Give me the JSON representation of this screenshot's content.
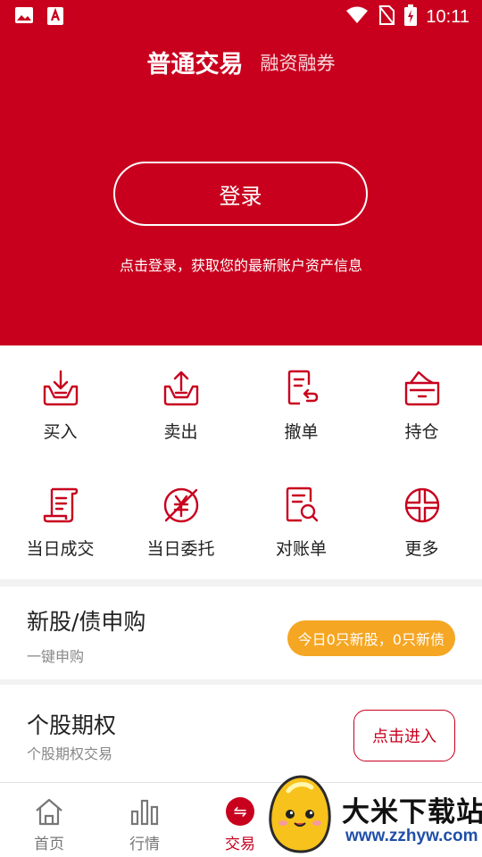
{
  "status_bar": {
    "time": "10:11",
    "icons": [
      "image-icon",
      "app-notification-icon",
      "wifi-icon",
      "no-sim-icon",
      "battery-charging-icon"
    ]
  },
  "header": {
    "tab_active": "普通交易",
    "tab_inactive": "融资融券",
    "login_button": "登录",
    "login_hint": "点击登录，获取您的最新账户资产信息"
  },
  "grid": [
    {
      "label": "买入",
      "icon": "buy-icon"
    },
    {
      "label": "卖出",
      "icon": "sell-icon"
    },
    {
      "label": "撤单",
      "icon": "cancel-order-icon"
    },
    {
      "label": "持仓",
      "icon": "position-icon"
    },
    {
      "label": "当日成交",
      "icon": "daily-deal-icon"
    },
    {
      "label": "当日委托",
      "icon": "daily-entrust-icon"
    },
    {
      "label": "对账单",
      "icon": "statement-icon"
    },
    {
      "label": "更多",
      "icon": "more-icon"
    }
  ],
  "ipo_card": {
    "title": "新股/债申购",
    "subtitle": "一键申购",
    "badge": "今日0只新股，0只新债"
  },
  "option_card": {
    "title": "个股期权",
    "subtitle": "个股期权交易",
    "button": "点击进入"
  },
  "bottom_nav": [
    {
      "label": "首页",
      "icon": "home-icon"
    },
    {
      "label": "行情",
      "icon": "market-chart-icon"
    },
    {
      "label": "交易",
      "icon": "trade-icon",
      "active": true
    }
  ],
  "watermark": {
    "text": "大米下载站",
    "url": "www.zzhyw.com"
  },
  "colors": {
    "brand_red": "#c8001e",
    "badge_orange": "#f5a623",
    "url_blue": "#1f4fa8"
  }
}
